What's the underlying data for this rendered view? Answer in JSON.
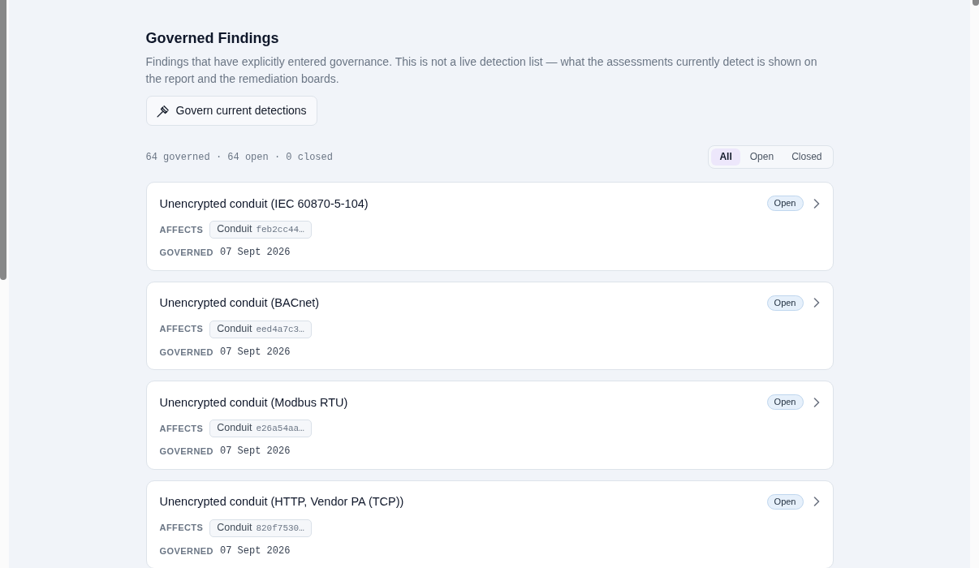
{
  "header": {
    "title": "Governed Findings",
    "description": "Findings that have explicitly entered governance. This is not a live detection list — what the assessments currently detect is shown on the report and the remediation boards.",
    "action_button": {
      "label": "Govern current detections"
    }
  },
  "summary": "64 governed · 64 open · 0 closed",
  "filters": [
    {
      "label": "All",
      "selected": true
    },
    {
      "label": "Open",
      "selected": false
    },
    {
      "label": "Closed",
      "selected": false
    }
  ],
  "findings": [
    {
      "title": "Unencrypted conduit (IEC 60870-5-104)",
      "status": "Open",
      "affects_label": "AFFECTS",
      "target_type": "Conduit",
      "target_id": "feb2cc44…",
      "governed_label": "GOVERNED",
      "governed_date": "07 Sept 2026"
    },
    {
      "title": "Unencrypted conduit (BACnet)",
      "status": "Open",
      "affects_label": "AFFECTS",
      "target_type": "Conduit",
      "target_id": "eed4a7c3…",
      "governed_label": "GOVERNED",
      "governed_date": "07 Sept 2026"
    },
    {
      "title": "Unencrypted conduit (Modbus RTU)",
      "status": "Open",
      "affects_label": "AFFECTS",
      "target_type": "Conduit",
      "target_id": "e26a54aa…",
      "governed_label": "GOVERNED",
      "governed_date": "07 Sept 2026"
    },
    {
      "title": "Unencrypted conduit (HTTP, Vendor PA (TCP))",
      "status": "Open",
      "affects_label": "AFFECTS",
      "target_type": "Conduit",
      "target_id": "820f7530…",
      "governed_label": "GOVERNED",
      "governed_date": "07 Sept 2026"
    }
  ]
}
